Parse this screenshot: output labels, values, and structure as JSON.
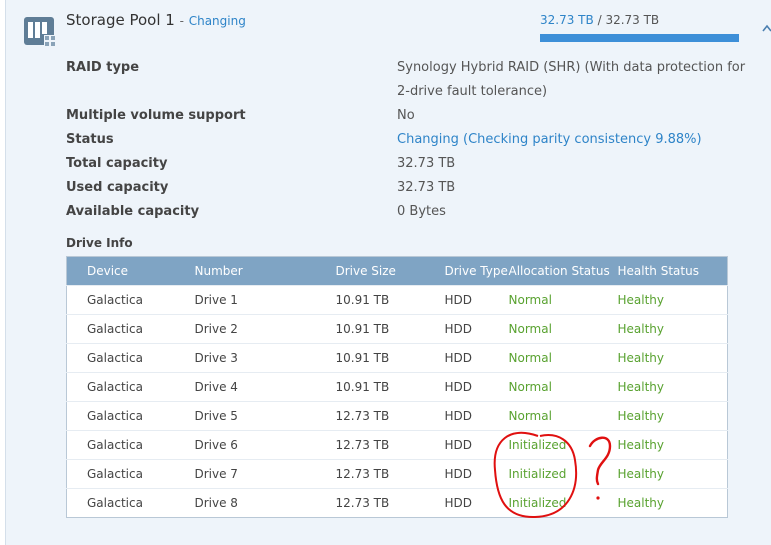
{
  "pool": {
    "name": "Storage Pool 1",
    "separator": "-",
    "state": "Changing",
    "used_capacity": "32.73 TB",
    "capacity_separator": "/",
    "total_capacity": "32.73 TB",
    "usage_fraction": 1.0,
    "icon": "storage-pool-icon"
  },
  "properties": [
    {
      "label": "RAID type",
      "value": "Synology Hybrid RAID (SHR) (With data protection for",
      "value2": "2-drive fault tolerance)"
    },
    {
      "label": "Multiple volume support",
      "value": "No"
    },
    {
      "label": "Status",
      "value_link": "Changing",
      "value_detail": "(Checking parity consistency 9.88%)"
    },
    {
      "label": "Total capacity",
      "value": "32.73 TB"
    },
    {
      "label": "Used capacity",
      "value": "32.73 TB"
    },
    {
      "label": "Available capacity",
      "value": "0 Bytes"
    }
  ],
  "drive_info": {
    "title": "Drive Info",
    "columns": [
      "Device",
      "Number",
      "Drive Size",
      "Drive Type",
      "Allocation Status",
      "Health Status"
    ],
    "rows": [
      {
        "device": "Galactica",
        "number": "Drive 1",
        "size": "10.91 TB",
        "type": "HDD",
        "allocation": "Normal",
        "health": "Healthy"
      },
      {
        "device": "Galactica",
        "number": "Drive 2",
        "size": "10.91 TB",
        "type": "HDD",
        "allocation": "Normal",
        "health": "Healthy"
      },
      {
        "device": "Galactica",
        "number": "Drive 3",
        "size": "10.91 TB",
        "type": "HDD",
        "allocation": "Normal",
        "health": "Healthy"
      },
      {
        "device": "Galactica",
        "number": "Drive 4",
        "size": "10.91 TB",
        "type": "HDD",
        "allocation": "Normal",
        "health": "Healthy"
      },
      {
        "device": "Galactica",
        "number": "Drive 5",
        "size": "12.73 TB",
        "type": "HDD",
        "allocation": "Normal",
        "health": "Healthy"
      },
      {
        "device": "Galactica",
        "number": "Drive 6",
        "size": "12.73 TB",
        "type": "HDD",
        "allocation": "Initialized",
        "health": "Healthy"
      },
      {
        "device": "Galactica",
        "number": "Drive 7",
        "size": "12.73 TB",
        "type": "HDD",
        "allocation": "Initialized",
        "health": "Healthy"
      },
      {
        "device": "Galactica",
        "number": "Drive 8",
        "size": "12.73 TB",
        "type": "HDD",
        "allocation": "Initialized",
        "health": "Healthy"
      }
    ]
  },
  "colors": {
    "accent": "#2e84c8",
    "status_green": "#59a230",
    "table_header": "#7fa4c4",
    "annotation": "#e01010"
  },
  "annotation": {
    "shape": "hand-drawn-circle-and-question-mark"
  }
}
